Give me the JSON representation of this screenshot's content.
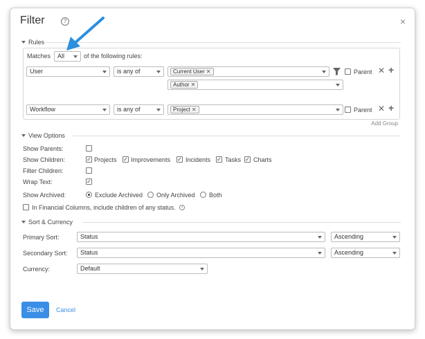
{
  "dialog": {
    "title": "Filter"
  },
  "rules": {
    "section_label": "Rules",
    "matches_label": "Matches",
    "matches_value": "All",
    "following_label": "of the following rules:",
    "rows": [
      {
        "field": "User",
        "operator": "is any of",
        "tags": [
          "Current User",
          "Author"
        ],
        "parent_label": "Parent"
      },
      {
        "field": "Workflow",
        "operator": "is any of",
        "tags": [
          "Project"
        ],
        "parent_label": "Parent"
      }
    ],
    "add_group_label": "Add Group"
  },
  "view_options": {
    "section_label": "View Options",
    "show_parents_label": "Show Parents:",
    "show_children_label": "Show Children:",
    "children_options": [
      "Projects",
      "Improvements",
      "Incidents",
      "Tasks",
      "Charts"
    ],
    "filter_children_label": "Filter Children:",
    "wrap_text_label": "Wrap Text:",
    "show_archived_label": "Show Archived:",
    "archived_options": [
      "Exclude Archived",
      "Only Archived",
      "Both"
    ],
    "financial_label": "In Financial Columns, include children of any status."
  },
  "sort_currency": {
    "section_label": "Sort & Currency",
    "primary_label": "Primary Sort:",
    "primary_value": "Status",
    "primary_order": "Ascending",
    "secondary_label": "Secondary Sort:",
    "secondary_value": "Status",
    "secondary_order": "Ascending",
    "currency_label": "Currency:",
    "currency_value": "Default"
  },
  "footer": {
    "save_label": "Save",
    "cancel_label": "Cancel"
  },
  "colors": {
    "accent": "#3a8ee6",
    "annotation_arrow": "#2b8fe0"
  }
}
